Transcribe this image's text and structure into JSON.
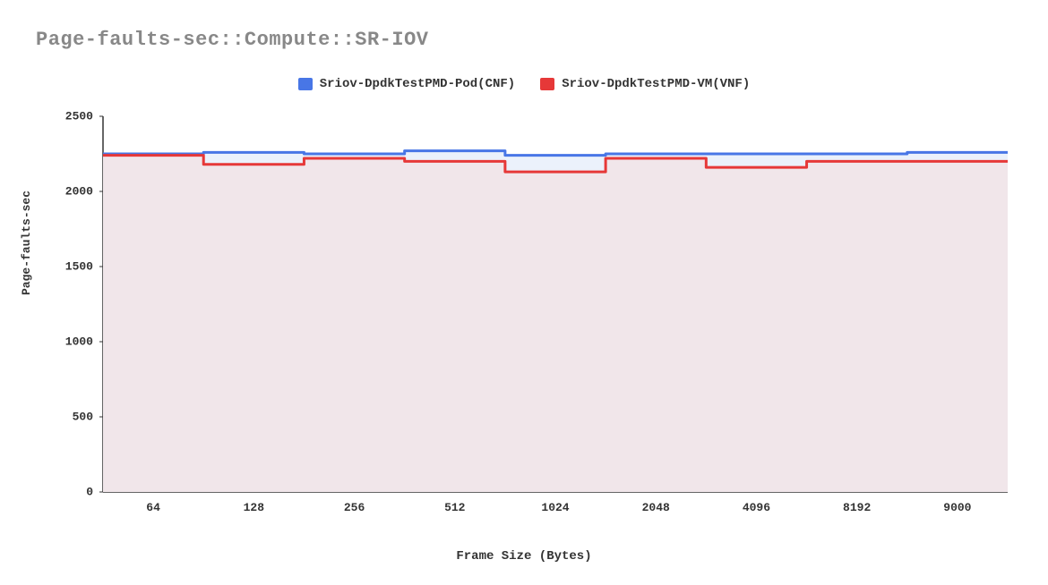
{
  "chart_data": {
    "type": "area",
    "title": "Page-faults-sec::Compute::SR-IOV",
    "xlabel": "Frame Size (Bytes)",
    "ylabel": "Page-faults-sec",
    "ylim": [
      0,
      2500
    ],
    "y_ticks": [
      0,
      500,
      1000,
      1500,
      2000,
      2500
    ],
    "categories": [
      "64",
      "128",
      "256",
      "512",
      "1024",
      "2048",
      "4096",
      "8192",
      "9000"
    ],
    "series": [
      {
        "name": "Sriov-DpdkTestPMD-Pod(CNF)",
        "color": "#4876e6",
        "fill": "#e9f0fb",
        "values": [
          2250,
          2260,
          2250,
          2270,
          2240,
          2250,
          2250,
          2250,
          2260
        ]
      },
      {
        "name": "Sriov-DpdkTestPMD-VM(VNF)",
        "color": "#e63838",
        "fill": "#f2e4e6",
        "values": [
          2240,
          2180,
          2220,
          2200,
          2130,
          2220,
          2160,
          2200,
          2200
        ]
      }
    ]
  }
}
